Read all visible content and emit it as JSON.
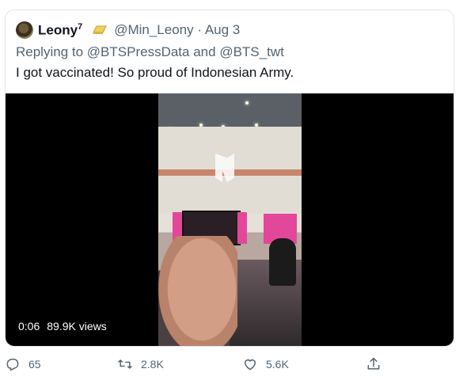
{
  "tweet": {
    "display_name": "Leony",
    "name_superscript": "7",
    "name_emoji": "gold-bar-emoji",
    "handle": "@Min_Leony",
    "separator": "·",
    "date": "Aug 3",
    "replying_prefix": "Replying to",
    "replying_user_1": "@BTSPressData",
    "replying_and": "and",
    "replying_user_2": "@BTS_twt",
    "text": "I got vaccinated! So proud of Indonesian Army.",
    "video": {
      "duration": "0:06",
      "views": "89.9K views"
    },
    "actions": {
      "replies": "65",
      "retweets": "2.8K",
      "likes": "5.6K"
    }
  },
  "icons": {
    "reply": "reply-icon",
    "retweet": "retweet-icon",
    "like": "heart-icon",
    "share": "share-icon"
  },
  "colors": {
    "text": "#0f1419",
    "secondary": "#536471",
    "border": "#e3e6e8"
  }
}
